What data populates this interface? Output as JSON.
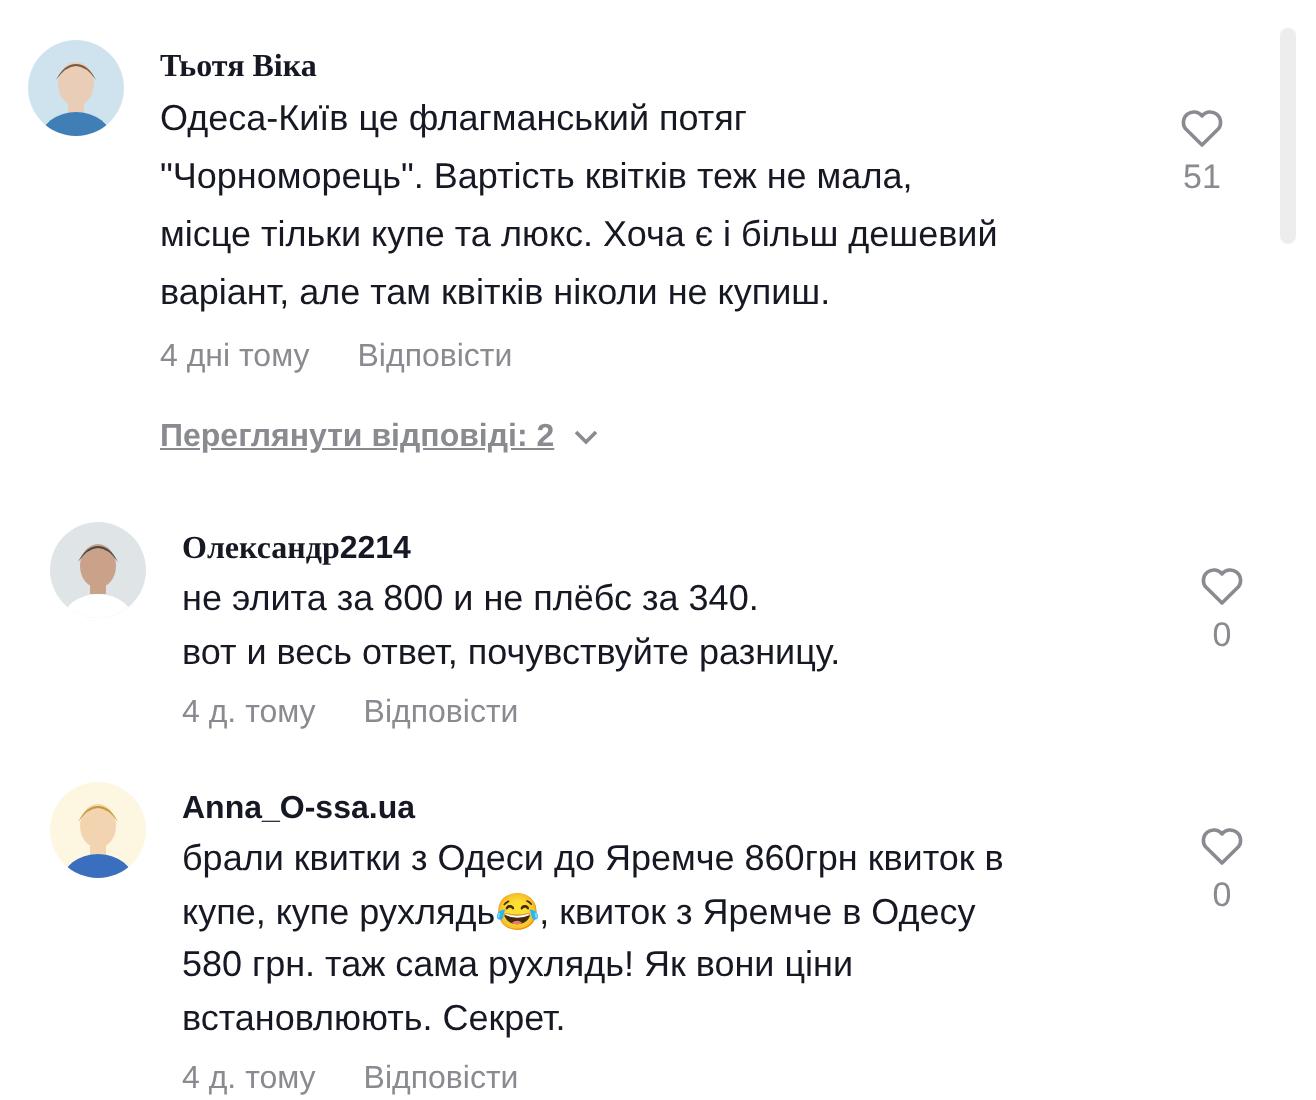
{
  "comments": [
    {
      "author": "Тьотя Віка",
      "text": "Одеса-Київ це флагманський потяг\n\"Чорноморець\". Вартість квітків теж не мала,\nмісце тільки купе та люкс. Хоча є і більш дешевий\nваріант, але там квітків ніколи не купиш.",
      "likes": "51",
      "date": "4 дні тому",
      "reply": "Відповісти",
      "view_replies": "Переглянути відповіді: 2",
      "is_reply": false
    },
    {
      "author": "Олександр2214",
      "text": "не элита за 800 и не плёбс за 340.\nвот и весь ответ, почувствуйте разницу.",
      "likes": "0",
      "date": "4 д. тому",
      "reply": "Відповісти",
      "is_reply": true
    },
    {
      "author": "Anna_O-ssa.ua",
      "text": "брали квитки з Одеси до Яремче 860грн квиток в\nкупе, купе рухлядь😂, квиток з Яремче в Одесу\n580 грн. таж сама рухлядь! Як вони ціни\nвстановлюють. Секрет.",
      "likes": "0",
      "date": "4 д. тому",
      "reply": "Відповісти",
      "is_reply": true
    }
  ]
}
